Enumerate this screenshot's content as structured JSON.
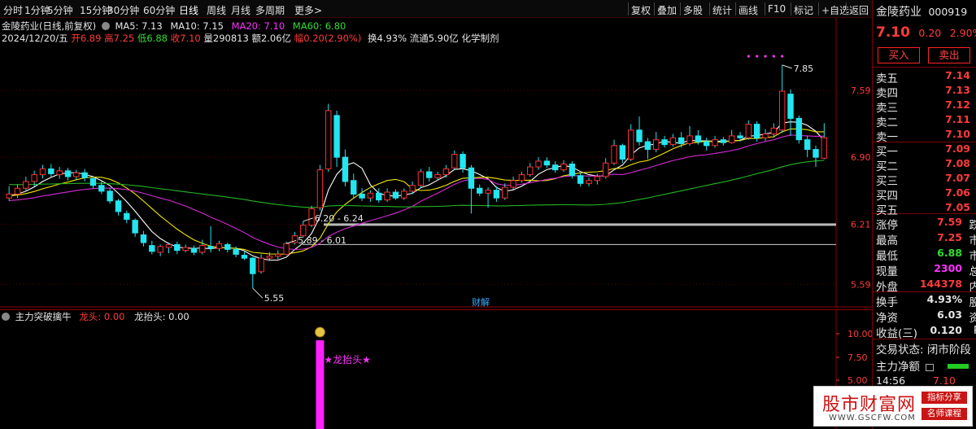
{
  "toolbar": {
    "left": [
      "分时",
      "1分钟",
      "5分钟",
      "15分钟",
      "30分钟",
      "60分钟",
      "日线",
      "周线",
      "月线",
      "多周期",
      "更多>"
    ],
    "right": [
      "复权",
      "叠加",
      "多股",
      "统计",
      "画线",
      "F10",
      "标记",
      "+自选",
      "返回"
    ]
  },
  "legend": {
    "stock_label": "金陵药业(日线,前复权)",
    "ma5": "MA5: 7.13",
    "ma10": "MA10: 7.15",
    "ma20": "MA20: 7.10",
    "ma60": "MA60: 6.80",
    "date": "2024/12/20/五",
    "open": "开6.89",
    "high": "高7.25",
    "low": "低6.88",
    "close": "收7.10",
    "volume": "量290813",
    "amount": "额2.06亿",
    "change": "幅0.20(2.90%)",
    "turnover": "换4.93%",
    "float_cap": "流通5.90亿",
    "sector": "化学制剂"
  },
  "chart_data": {
    "type": "candlestick",
    "x_label": "",
    "y_ticks": [
      7.59,
      6.9,
      6.21,
      5.59
    ],
    "ylim": [
      5.45,
      8.0
    ],
    "colors": {
      "up": "#22e6f0",
      "down": "#22e6f0",
      "up_body": "#000000",
      "down_body": "#22e6f0",
      "ma5": "#ffffff",
      "ma10": "#f2e600",
      "ma20": "#d42bd4",
      "ma60": "#22b422"
    },
    "candles": [
      [
        6.48,
        6.52,
        6.6,
        6.45
      ],
      [
        6.52,
        6.58,
        6.62,
        6.48
      ],
      [
        6.58,
        6.65,
        6.7,
        6.55
      ],
      [
        6.65,
        6.72,
        6.76,
        6.6
      ],
      [
        6.72,
        6.78,
        6.82,
        6.68
      ],
      [
        6.78,
        6.73,
        6.83,
        6.7
      ],
      [
        6.72,
        6.76,
        6.8,
        6.68
      ],
      [
        6.76,
        6.7,
        6.79,
        6.66
      ],
      [
        6.7,
        6.74,
        6.77,
        6.67
      ],
      [
        6.74,
        6.69,
        6.78,
        6.65
      ],
      [
        6.68,
        6.61,
        6.7,
        6.58
      ],
      [
        6.61,
        6.55,
        6.65,
        6.52
      ],
      [
        6.55,
        6.45,
        6.58,
        6.42
      ],
      [
        6.45,
        6.34,
        6.47,
        6.3
      ],
      [
        6.32,
        6.26,
        6.35,
        6.22
      ],
      [
        6.25,
        6.12,
        6.27,
        6.08
      ],
      [
        6.1,
        6.02,
        6.14,
        5.98
      ],
      [
        5.99,
        5.93,
        6.04,
        5.9
      ],
      [
        5.92,
        5.98,
        6.0,
        5.88
      ],
      [
        5.97,
        6.0,
        6.02,
        5.91
      ],
      [
        6.0,
        5.94,
        6.03,
        5.9
      ],
      [
        5.94,
        5.97,
        6.0,
        5.92
      ],
      [
        5.96,
        5.92,
        5.99,
        5.89
      ],
      [
        5.92,
        5.99,
        6.05,
        5.9
      ],
      [
        5.98,
        5.96,
        6.19,
        5.92
      ],
      [
        5.96,
        6.01,
        6.04,
        5.93
      ],
      [
        6.0,
        5.95,
        6.02,
        5.92
      ],
      [
        5.95,
        5.9,
        5.98,
        5.87
      ],
      [
        5.89,
        5.86,
        5.93,
        5.84
      ],
      [
        5.86,
        5.7,
        5.87,
        5.55
      ],
      [
        5.72,
        5.86,
        5.9,
        5.7
      ],
      [
        5.86,
        5.88,
        5.92,
        5.83
      ],
      [
        5.88,
        5.9,
        5.94,
        5.85
      ],
      [
        5.9,
        6.01,
        6.03,
        5.89
      ],
      [
        6.02,
        6.09,
        6.13,
        6.0
      ],
      [
        6.09,
        6.2,
        6.24,
        6.07
      ],
      [
        6.2,
        6.37,
        6.4,
        6.18
      ],
      [
        6.38,
        6.77,
        6.82,
        6.35
      ],
      [
        6.78,
        7.38,
        7.45,
        6.75
      ],
      [
        7.33,
        6.9,
        7.38,
        6.8
      ],
      [
        6.9,
        6.65,
        6.98,
        6.6
      ],
      [
        6.66,
        6.52,
        6.73,
        6.48
      ],
      [
        6.52,
        6.48,
        6.58,
        6.45
      ],
      [
        6.48,
        6.53,
        6.56,
        6.44
      ],
      [
        6.53,
        6.46,
        6.58,
        6.43
      ],
      [
        6.46,
        6.54,
        6.58,
        6.44
      ],
      [
        6.54,
        6.48,
        6.57,
        6.46
      ],
      [
        6.48,
        6.55,
        6.58,
        6.46
      ],
      [
        6.55,
        6.61,
        6.65,
        6.52
      ],
      [
        6.61,
        6.75,
        6.78,
        6.58
      ],
      [
        6.75,
        6.69,
        6.8,
        6.65
      ],
      [
        6.69,
        6.72,
        6.75,
        6.66
      ],
      [
        6.72,
        6.78,
        6.82,
        6.69
      ],
      [
        6.79,
        6.93,
        6.97,
        6.77
      ],
      [
        6.93,
        6.79,
        6.96,
        6.74
      ],
      [
        6.79,
        6.58,
        6.82,
        6.32
      ],
      [
        6.58,
        6.53,
        6.62,
        6.5
      ],
      [
        6.53,
        6.56,
        6.59,
        6.38
      ],
      [
        6.56,
        6.48,
        6.6,
        6.44
      ],
      [
        6.48,
        6.59,
        6.63,
        6.46
      ],
      [
        6.59,
        6.66,
        6.7,
        6.57
      ],
      [
        6.66,
        6.72,
        6.75,
        6.64
      ],
      [
        6.72,
        6.8,
        6.84,
        6.7
      ],
      [
        6.8,
        6.86,
        6.9,
        6.77
      ],
      [
        6.86,
        6.82,
        6.9,
        6.79
      ],
      [
        6.82,
        6.77,
        6.86,
        6.74
      ],
      [
        6.77,
        6.83,
        6.87,
        6.75
      ],
      [
        6.83,
        6.71,
        6.86,
        6.68
      ],
      [
        6.71,
        6.63,
        6.74,
        6.6
      ],
      [
        6.63,
        6.66,
        6.69,
        6.6
      ],
      [
        6.66,
        6.7,
        6.73,
        6.62
      ],
      [
        6.7,
        6.84,
        6.89,
        6.68
      ],
      [
        6.84,
        7.02,
        7.08,
        6.82
      ],
      [
        7.02,
        6.88,
        7.04,
        6.84
      ],
      [
        6.88,
        7.18,
        7.24,
        6.86
      ],
      [
        7.18,
        7.06,
        7.32,
        7.02
      ],
      [
        7.06,
        6.98,
        7.1,
        6.88
      ],
      [
        6.98,
        7.08,
        7.16,
        6.95
      ],
      [
        7.08,
        7.03,
        7.12,
        7.0
      ],
      [
        7.03,
        7.1,
        7.14,
        7.01
      ],
      [
        7.1,
        7.04,
        7.16,
        7.0
      ],
      [
        7.04,
        7.12,
        7.22,
        7.02
      ],
      [
        7.12,
        7.06,
        7.18,
        7.03
      ],
      [
        7.06,
        7.02,
        7.1,
        6.97
      ],
      [
        7.02,
        7.08,
        7.12,
        7.0
      ],
      [
        7.08,
        7.05,
        7.11,
        7.02
      ],
      [
        7.05,
        7.12,
        7.18,
        7.04
      ],
      [
        7.12,
        7.1,
        7.16,
        7.06
      ],
      [
        7.1,
        7.24,
        7.28,
        7.08
      ],
      [
        7.24,
        7.1,
        7.27,
        7.06
      ],
      [
        7.1,
        7.14,
        7.19,
        7.07
      ],
      [
        7.14,
        7.2,
        7.25,
        7.1
      ],
      [
        7.18,
        7.58,
        7.85,
        7.15
      ],
      [
        7.55,
        7.3,
        7.6,
        7.12
      ],
      [
        7.3,
        7.08,
        7.33,
        7.04
      ],
      [
        7.08,
        6.98,
        7.12,
        6.9
      ],
      [
        6.98,
        6.9,
        7.02,
        6.8
      ],
      [
        6.89,
        7.1,
        7.25,
        6.88
      ]
    ],
    "ma5_label": "MA5",
    "annotations": [
      {
        "text": "7.85",
        "price": 7.85,
        "index": 92
      },
      {
        "text": "5.55",
        "price": 5.55,
        "index": 29
      },
      {
        "text": "6.20 - 6.24",
        "price": 6.24,
        "index": 35
      },
      {
        "text": "5.89 - 6.01",
        "price": 6.01,
        "index": 33
      }
    ],
    "horizontal_lines": [
      6.21,
      6.0
    ],
    "cai_jie_label": "财解"
  },
  "indicator": {
    "name": "主力突破擒牛",
    "dragon_head_label": "龙头: 0.00",
    "dragon_raise_label": "龙抬头: 0.00",
    "bar_label": "★龙抬头★",
    "y_ticks": [
      "10.00",
      "7.50",
      "5.00"
    ],
    "signal_index": 37
  },
  "panel": {
    "name": "金陵药业",
    "code": "000919",
    "price": "7.10",
    "change": "0.20",
    "pct": "2.90%",
    "buy_btn": "买入",
    "sell_btn": "卖出",
    "asks": [
      [
        "卖五",
        "7.14"
      ],
      [
        "卖四",
        "7.13"
      ],
      [
        "卖三",
        "7.12"
      ],
      [
        "卖二",
        "7.11"
      ],
      [
        "卖一",
        "7.10"
      ]
    ],
    "bids": [
      [
        "买一",
        "7.09"
      ],
      [
        "买二",
        "7.08"
      ],
      [
        "买三",
        "7.07"
      ],
      [
        "买四",
        "7.06"
      ],
      [
        "买五",
        "7.05"
      ]
    ],
    "stats": [
      [
        "涨停",
        "7.59",
        "跌"
      ],
      [
        "最高",
        "7.25",
        "市"
      ],
      [
        "最低",
        "6.88",
        "市"
      ],
      [
        "现量",
        "2300",
        "总"
      ],
      [
        "外盘",
        "144378",
        "内"
      ]
    ],
    "ratios": [
      [
        "换手",
        "4.93%",
        "股"
      ],
      [
        "净资",
        "6.03",
        "资"
      ],
      [
        "收益(三)",
        "0.120",
        "P"
      ]
    ],
    "trade_status": "交易状态: 闭市阶段",
    "net_flow": "主力净额",
    "time": "14:56",
    "time_price": "7.10"
  },
  "watermark": {
    "title": "股市财富网",
    "url": "WWW.GSCFW.COM",
    "tag1": "指标分享",
    "tag2": "名师课程"
  }
}
